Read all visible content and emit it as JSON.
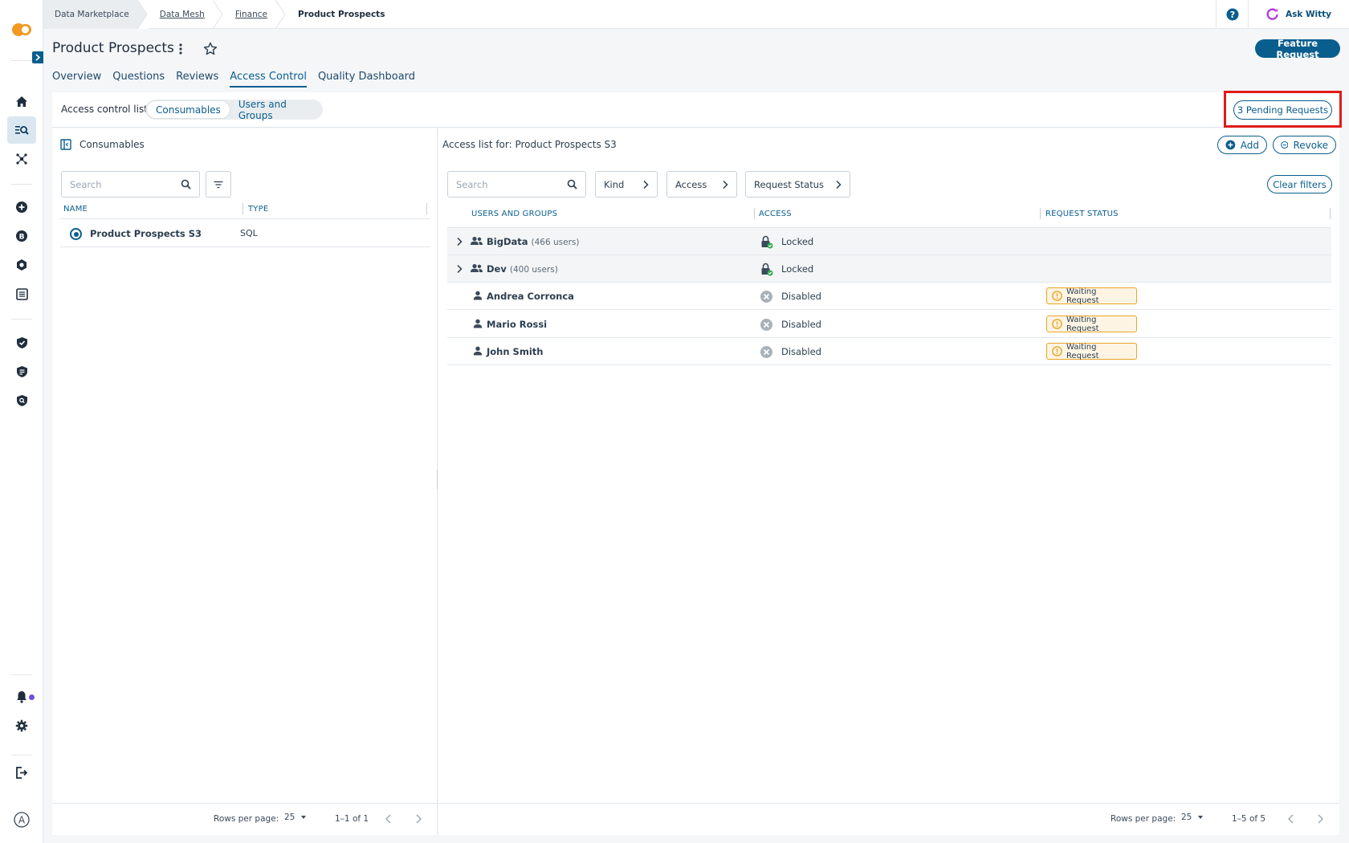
{
  "breadcrumbs": [
    "Data Marketplace",
    "Data Mesh",
    "Finance",
    "Product Prospects"
  ],
  "topbar": {
    "ask_label": "Ask Witty"
  },
  "page": {
    "title": "Product Prospects",
    "feature_request_label": "Feature Request"
  },
  "tabs": [
    "Overview",
    "Questions",
    "Reviews",
    "Access Control",
    "Quality Dashboard"
  ],
  "active_tab": "Access Control",
  "acl": {
    "label": "Access control list",
    "segments": [
      "Consumables",
      "Users and Groups"
    ],
    "active_segment": "Consumables",
    "pending_label": "3 Pending Requests"
  },
  "left_panel": {
    "title": "Consumables",
    "search_placeholder": "Search",
    "columns": [
      "NAME",
      "TYPE"
    ],
    "rows": [
      {
        "name": "Product Prospects S3",
        "type": "SQL"
      }
    ],
    "footer": {
      "rows_per_page_label": "Rows per page:",
      "rows_per_page": "25",
      "range": "1–1 of 1"
    }
  },
  "right_panel": {
    "title": "Access list for: Product Prospects S3",
    "add_label": "Add",
    "revoke_label": "Revoke",
    "search_placeholder": "Search",
    "filters": [
      "Kind",
      "Access",
      "Request Status"
    ],
    "clear_label": "Clear filters",
    "columns": [
      "USERS AND GROUPS",
      "ACCESS",
      "REQUEST STATUS"
    ],
    "rows": [
      {
        "kind": "group",
        "name": "BigData",
        "count": "(466 users)",
        "access": "Locked",
        "status": ""
      },
      {
        "kind": "group",
        "name": "Dev",
        "count": "(400 users)",
        "access": "Locked",
        "status": ""
      },
      {
        "kind": "user",
        "name": "Andrea Corronca",
        "count": "",
        "access": "Disabled",
        "status": "Waiting Request"
      },
      {
        "kind": "user",
        "name": "Mario Rossi",
        "count": "",
        "access": "Disabled",
        "status": "Waiting Request"
      },
      {
        "kind": "user",
        "name": "John Smith",
        "count": "",
        "access": "Disabled",
        "status": "Waiting Request"
      }
    ],
    "footer": {
      "rows_per_page_label": "Rows per page:",
      "rows_per_page": "25",
      "range": "1–5 of 5"
    }
  },
  "colors": {
    "primary": "#0a5e8e",
    "warning": "#e9a527",
    "highlight": "#e11b1b",
    "brand_orange": "#f29a1f"
  },
  "icons": [
    "home-icon",
    "catalog-search-icon",
    "mesh-icon",
    "add-circle-icon",
    "bitcoin-icon",
    "hexagon-icon",
    "list-icon",
    "shield-check-icon",
    "shield-list-icon",
    "shield-search-icon",
    "bell-icon",
    "gear-icon",
    "logout-icon",
    "avatar-icon"
  ]
}
